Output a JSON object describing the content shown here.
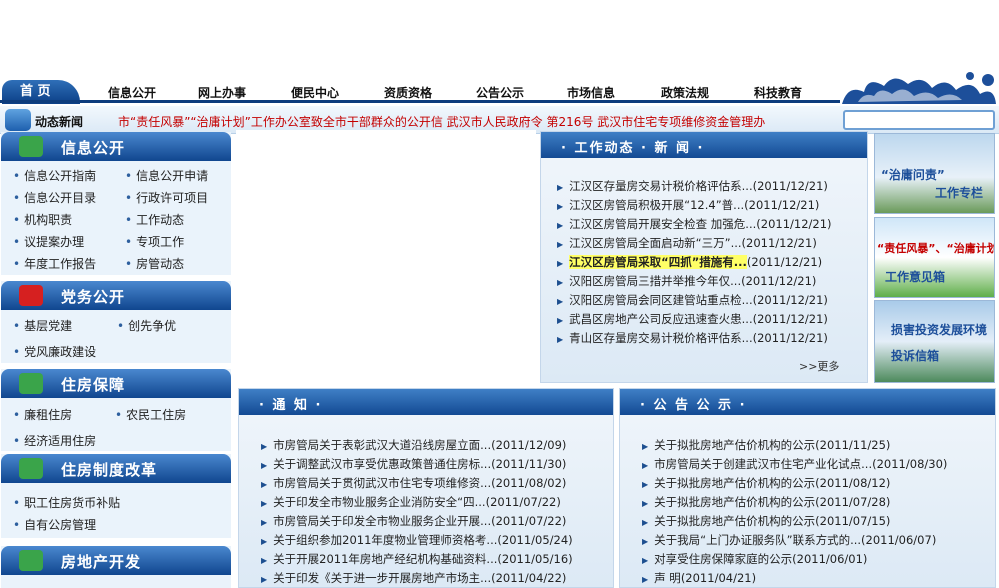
{
  "nav": {
    "home": "首  页",
    "items": [
      "信息公开",
      "网上办事",
      "便民中心",
      "资质资格",
      "公告公示",
      "市场信息",
      "政策法规",
      "科技教育"
    ]
  },
  "ticker": {
    "label": "动态新闻",
    "text": "市“责任风暴”“治庸计划”工作办公室致全市干部群众的公开信          武汉市人民政府令  第216号  武汉市住宅专项维修资金管理办"
  },
  "sidebar": {
    "info": {
      "title": "信息公开",
      "items": [
        "信息公开指南",
        "信息公开申请",
        "信息公开目录",
        "行政许可项目",
        "机构职责",
        "工作动态",
        "议提案办理",
        "专项工作",
        "年度工作报告",
        "房管动态"
      ]
    },
    "party": {
      "title": "党务公开",
      "items": [
        "基层党建",
        "创先争优",
        "党风廉政建设"
      ]
    },
    "housing": {
      "title": "住房保障",
      "items": [
        "廉租住房",
        "农民工住房",
        "经济适用住房"
      ]
    },
    "reform": {
      "title": "住房制度改革",
      "items": [
        "职工住房货币补贴",
        "自有公房管理"
      ]
    },
    "dev": {
      "title": "房地产开发"
    }
  },
  "work_news": {
    "title": "·  工作动态  ·  新  闻  ·",
    "items": [
      {
        "title": "江汉区存量房交易计税价格评估系...",
        "date": "(2011/12/21)"
      },
      {
        "title": "江汉区房管局积极开展“12.4”普...",
        "date": "(2011/12/21)"
      },
      {
        "title": "江汉区房管局开展安全检查 加强危...",
        "date": "(2011/12/21)"
      },
      {
        "title": "江汉区房管局全面启动新“三万”...",
        "date": "(2011/12/21)"
      },
      {
        "title": "江汉区房管局采取“四抓”措施有...",
        "date": "(2011/12/21)"
      },
      {
        "title": "汉阳区房管局三措并举推今年仅...",
        "date": "(2011/12/21)"
      },
      {
        "title": "汉阳区房管局会同区建管站重点检...",
        "date": "(2011/12/21)"
      },
      {
        "title": "武昌区房地产公司反应迅速查火患...",
        "date": "(2011/12/21)"
      },
      {
        "title": "青山区存量房交易计税价格评估系...",
        "date": "(2011/12/21)"
      }
    ],
    "more": ">>更多"
  },
  "notice": {
    "title": "·  通   知  ·",
    "items": [
      {
        "title": "市房管局关于表彰武汉大道沿线房屋立面...",
        "date": "(2011/12/09)"
      },
      {
        "title": "关于调整武汉市享受优惠政策普通住房标...",
        "date": "(2011/11/30)"
      },
      {
        "title": "市房管局关于贯彻武汉市住宅专项维修资...",
        "date": "(2011/08/02)"
      },
      {
        "title": "关于印发全市物业服务企业消防安全“四...",
        "date": "(2011/07/22)"
      },
      {
        "title": "市房管局关于印发全市物业服务企业开展...",
        "date": "(2011/07/22)"
      },
      {
        "title": "关于组织参加2011年度物业管理师资格考...",
        "date": "(2011/05/24)"
      },
      {
        "title": "关于开展2011年房地产经纪机构基础资料...",
        "date": "(2011/05/16)"
      },
      {
        "title": "关于印发《关于进一步开展房地产市场主...",
        "date": "(2011/04/22)"
      }
    ]
  },
  "announce": {
    "title": "·  公 告 公 示  ·",
    "items": [
      {
        "title": "关于拟批房地产估价机构的公示",
        "date": "(2011/11/25)"
      },
      {
        "title": "市房管局关于创建武汉市住宅产业化试点...",
        "date": "(2011/08/30)"
      },
      {
        "title": "关于拟批房地产估价机构的公示",
        "date": "(2011/08/12)"
      },
      {
        "title": "关于拟批房地产估价机构的公示",
        "date": "(2011/07/28)"
      },
      {
        "title": "关于拟批房地产估价机构的公示",
        "date": "(2011/07/15)"
      },
      {
        "title": "关于我局“上门办证服务队”联系方式的...",
        "date": "(2011/06/07)"
      },
      {
        "title": "对享受住房保障家庭的公示",
        "date": "(2011/06/01)"
      },
      {
        "title": "声  明",
        "date": "(2011/04/21)"
      }
    ]
  },
  "banners": [
    {
      "text1": "“治庸问责”",
      "text2": "工作专栏"
    },
    {
      "text1": "“责任风暴”、“治庸计划”",
      "text2": "工作意见箱"
    },
    {
      "text1": "损害投资发展环境",
      "text2": "投诉信箱"
    }
  ]
}
